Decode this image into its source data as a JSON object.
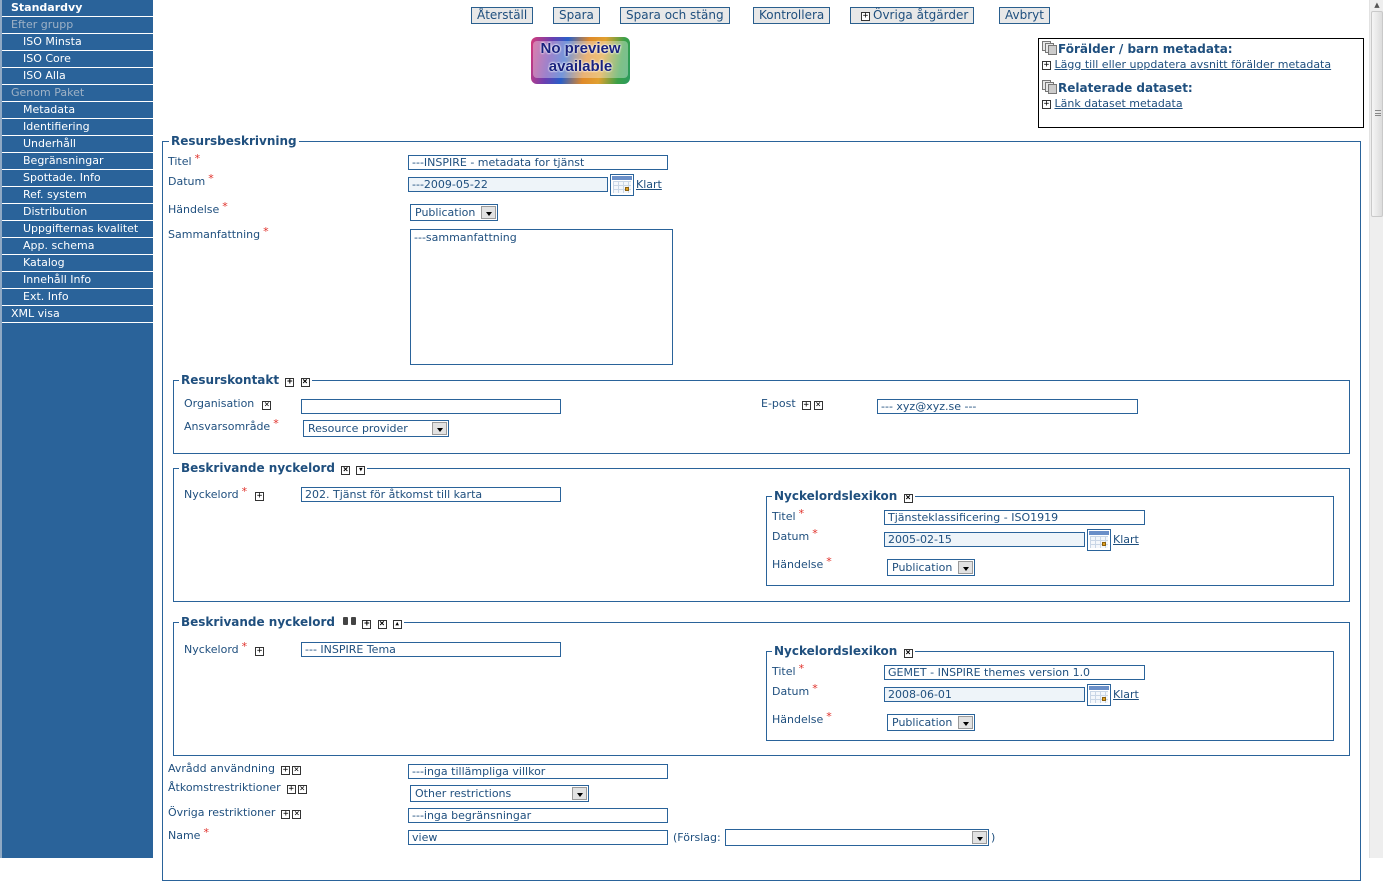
{
  "sidebar": {
    "items": [
      {
        "label": "Standardvy",
        "style": "bold"
      },
      {
        "label": "Efter grupp",
        "style": "disabled"
      },
      {
        "label": "ISO Minsta",
        "style": "sub"
      },
      {
        "label": "ISO Core",
        "style": "sub"
      },
      {
        "label": "ISO Alla",
        "style": "sub"
      },
      {
        "label": "Genom Paket",
        "style": "disabled"
      },
      {
        "label": "Metadata",
        "style": "sub"
      },
      {
        "label": "Identifiering",
        "style": "sub"
      },
      {
        "label": "Underhåll",
        "style": "sub"
      },
      {
        "label": "Begränsningar",
        "style": "sub"
      },
      {
        "label": "Spottade. Info",
        "style": "sub"
      },
      {
        "label": "Ref. system",
        "style": "sub"
      },
      {
        "label": "Distribution",
        "style": "sub"
      },
      {
        "label": "Uppgifternas kvalitet",
        "style": "sub"
      },
      {
        "label": "App. schema",
        "style": "sub"
      },
      {
        "label": "Katalog",
        "style": "sub"
      },
      {
        "label": "Innehåll Info",
        "style": "sub"
      },
      {
        "label": "Ext. Info",
        "style": "sub"
      },
      {
        "label": "XML visa",
        "style": "top"
      }
    ]
  },
  "toolbar": {
    "reset": "Återställ",
    "save": "Spara",
    "save_close": "Spara och stäng",
    "check": "Kontrollera",
    "other_actions": "Övriga åtgärder",
    "cancel": "Avbryt"
  },
  "preview": {
    "line1": "No preview",
    "line2": "available"
  },
  "related": {
    "parent_heading": "Förälder / barn metadata:",
    "parent_link": "Lägg till eller uppdatera avsnitt förälder metadata",
    "dataset_heading": "Relaterade dataset:",
    "dataset_link": "Länk dataset metadata"
  },
  "resource": {
    "legend": "Resursbeskrivning",
    "title_label": "Titel",
    "title_value": "---INSPIRE - metadata for tjänst",
    "date_label": "Datum",
    "date_value": "---2009-05-22",
    "done_label": "Klart",
    "event_label": "Händelse",
    "event_value": "Publication",
    "abstract_label": "Sammanfattning",
    "abstract_value": "---sammanfattning",
    "required_mark": "*"
  },
  "contact": {
    "legend": "Resurskontakt",
    "org_label": "Organisation",
    "org_value": "",
    "role_label": "Ansvarsområde",
    "role_value": "Resource provider",
    "email_label": "E-post",
    "email_value": "--- xyz@xyz.se ---"
  },
  "keywords": [
    {
      "legend": "Beskrivande nyckelord",
      "keyword_label": "Nyckelord",
      "keyword_value": "202. Tjänst för åtkomst till karta",
      "thesaurus": {
        "legend": "Nyckelordslexikon",
        "title_label": "Titel",
        "title_value": "Tjänsteklassificering - ISO1919",
        "date_label": "Datum",
        "date_value": "2005-02-15",
        "done_label": "Klart",
        "event_label": "Händelse",
        "event_value": "Publication"
      }
    },
    {
      "legend": "Beskrivande nyckelord",
      "keyword_label": "Nyckelord",
      "keyword_value": "--- INSPIRE Tema",
      "thesaurus": {
        "legend": "Nyckelordslexikon",
        "title_label": "Titel",
        "title_value": "GEMET - INSPIRE themes version 1.0",
        "date_label": "Datum",
        "date_value": "2008-06-01",
        "done_label": "Klart",
        "event_label": "Händelse",
        "event_value": "Publication"
      }
    }
  ],
  "constraints": {
    "use_label": "Avrådd användning",
    "use_value": "---inga tillämpliga villkor",
    "access_label": "Åtkomstrestriktioner",
    "access_value": "Other restrictions",
    "other_label": "Övriga restriktioner",
    "other_value": "---inga begränsningar",
    "name_label": "Name",
    "name_value": "view",
    "suggest_label": "(Förslag:",
    "suggest_close": ")",
    "suggest_value": ""
  },
  "icons": {
    "plus": "+",
    "remove": "×",
    "down": "▾",
    "up": "▴"
  }
}
